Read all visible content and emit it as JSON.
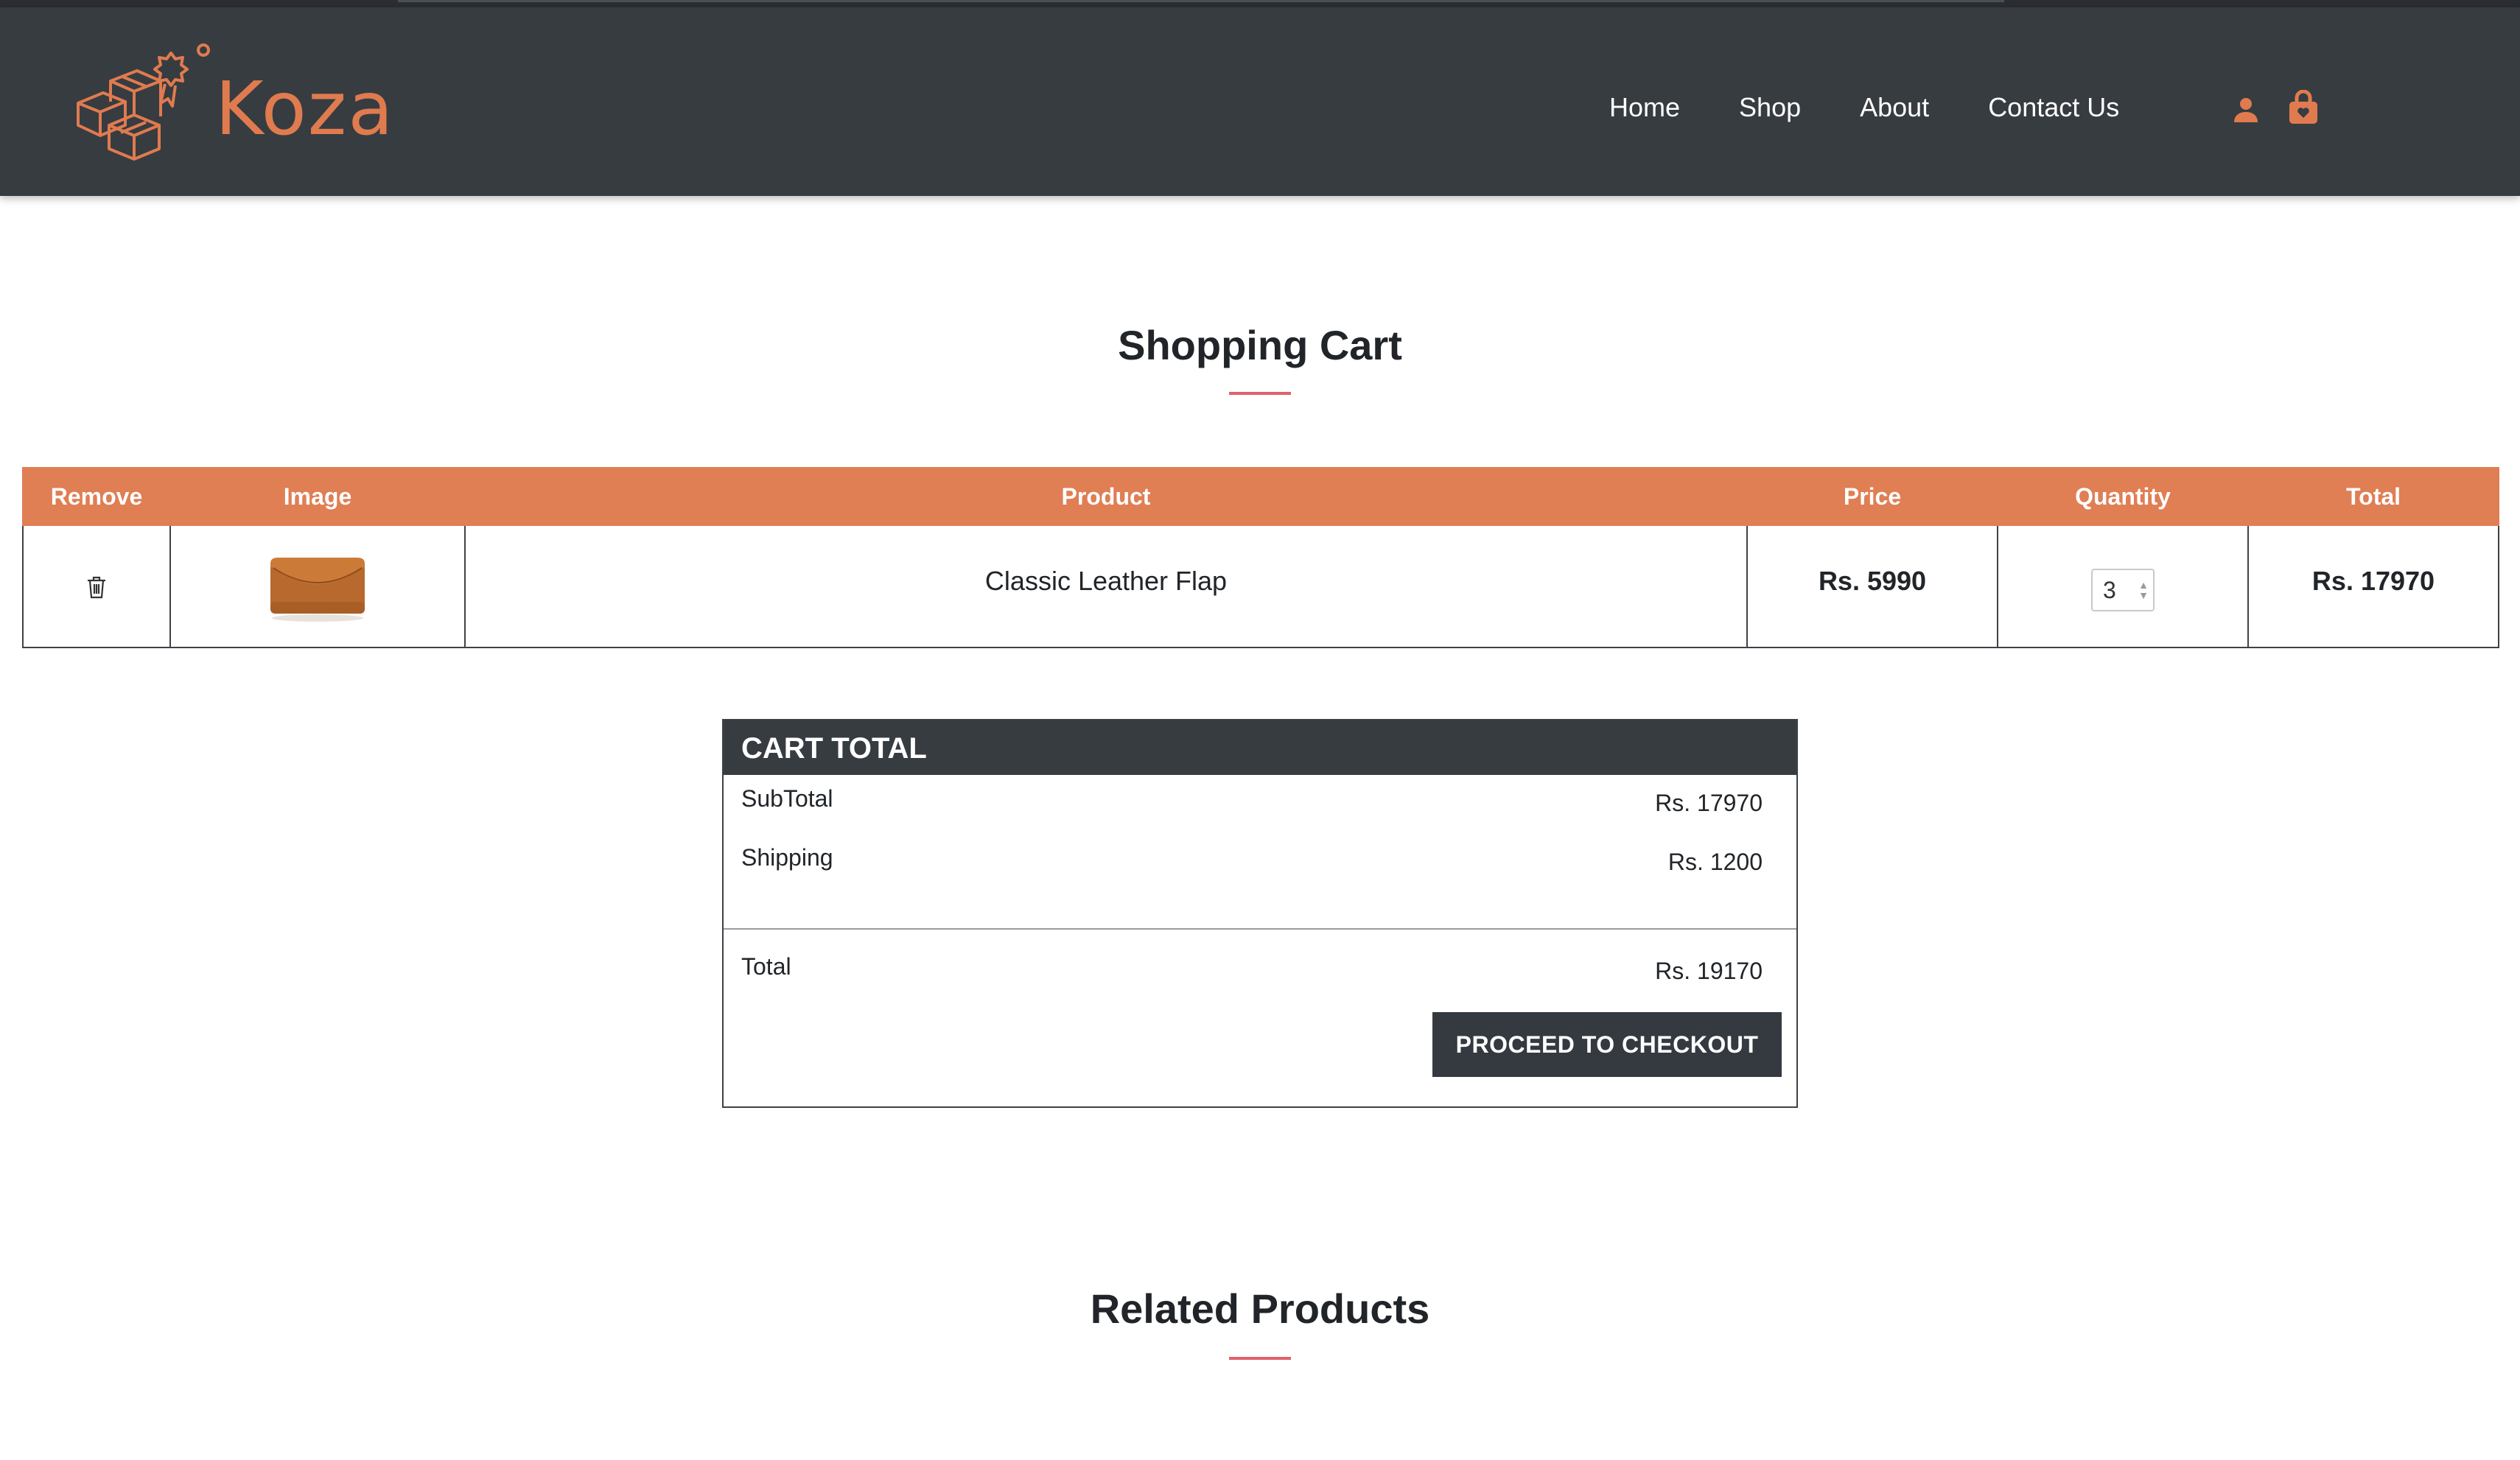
{
  "brand": {
    "name": "Koza",
    "accent": "#e07b4f",
    "header_bg": "#373c41"
  },
  "nav": {
    "items": [
      {
        "label": "Home"
      },
      {
        "label": "Shop"
      },
      {
        "label": "About"
      },
      {
        "label": "Contact Us"
      }
    ],
    "icons": [
      "user-icon",
      "shopping-bag-icon"
    ]
  },
  "page": {
    "title": "Shopping Cart"
  },
  "cart_table": {
    "headers": {
      "remove": "Remove",
      "image": "Image",
      "product": "Product",
      "price": "Price",
      "quantity": "Quantity",
      "total": "Total"
    },
    "rows": [
      {
        "remove_icon": "trash-icon",
        "image": "leather-clutch-bag",
        "product": "Classic Leather Flap",
        "price": "Rs. 5990",
        "quantity": "3",
        "total": "Rs. 17970"
      }
    ]
  },
  "cart_total": {
    "heading": "CART TOTAL",
    "subtotal_label": "SubTotal",
    "subtotal_value": "Rs. 17970",
    "shipping_label": "Shipping",
    "shipping_value": "Rs. 1200",
    "total_label": "Total",
    "total_value": "Rs. 19170",
    "checkout_button": "PROCEED TO CHECKOUT"
  },
  "related": {
    "title": "Related Products"
  },
  "colors": {
    "table_header": "#e07e54",
    "underline": "#e0616b",
    "button": "#343a40"
  }
}
